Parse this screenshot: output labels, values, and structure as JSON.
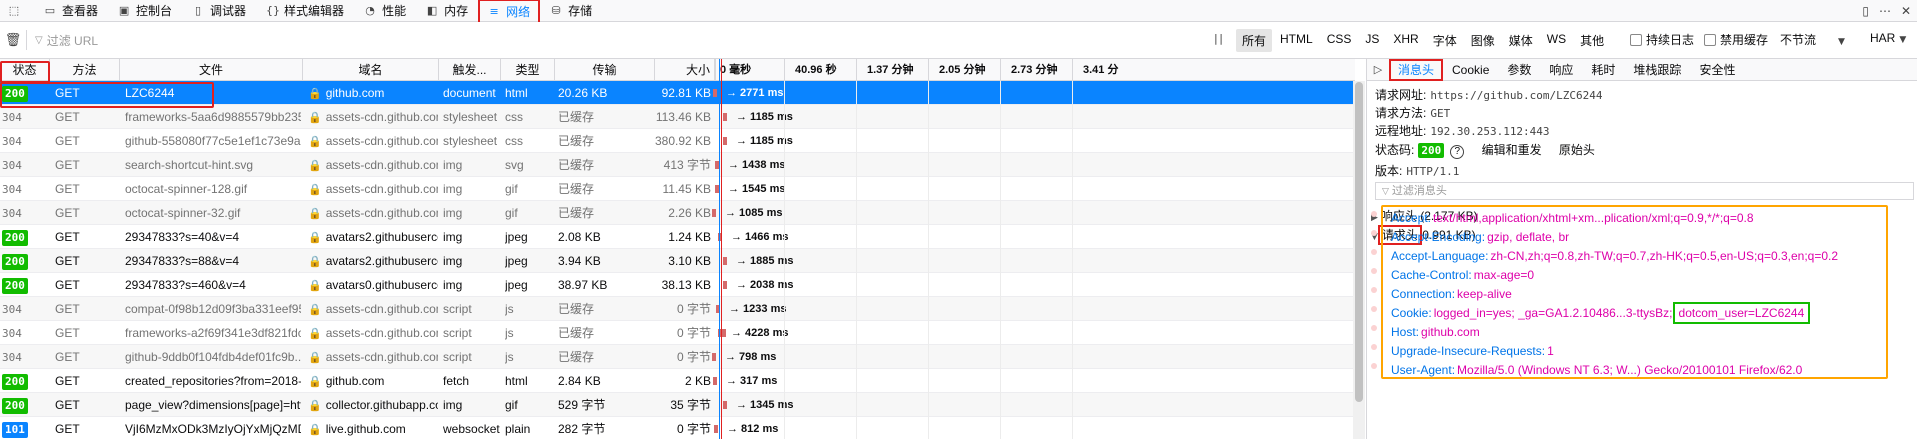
{
  "toolbar": {
    "tabs": [
      {
        "label": "查看器",
        "icon": "inspector-icon"
      },
      {
        "label": "控制台",
        "icon": "console-icon"
      },
      {
        "label": "调试器",
        "icon": "debugger-icon"
      },
      {
        "label": "样式编辑器",
        "icon": "style-editor-icon"
      },
      {
        "label": "性能",
        "icon": "performance-icon"
      },
      {
        "label": "内存",
        "icon": "memory-icon"
      },
      {
        "label": "网络",
        "icon": "network-icon"
      },
      {
        "label": "存储",
        "icon": "storage-icon"
      }
    ],
    "active_tab": "网络"
  },
  "filterbar": {
    "placeholder": "过滤 URL",
    "type_filters": [
      "所有",
      "HTML",
      "CSS",
      "JS",
      "XHR",
      "字体",
      "图像",
      "媒体",
      "WS",
      "其他"
    ],
    "selected_type": "所有",
    "persist_logs": "持续日志",
    "disable_cache": "禁用缓存",
    "throttle": "不节流",
    "har": "HAR"
  },
  "table": {
    "headers": {
      "status": "状态",
      "method": "方法",
      "file": "文件",
      "domain": "域名",
      "cause": "触发...",
      "type": "类型",
      "transferred": "传输",
      "size": "大小",
      "timeline_start": "0 毫秒",
      "ticks": [
        "40.96 秒",
        "1.37 分钟",
        "2.05 分钟",
        "2.73 分钟",
        "3.41 分"
      ]
    },
    "rows": [
      {
        "status": "200",
        "method": "GET",
        "file": "LZC6244",
        "domain": "github.com",
        "cause": "document",
        "type": "html",
        "transferred": "20.26 KB",
        "size": "92.81 KB",
        "time": "→ 2771 ms",
        "selected": true
      },
      {
        "status": "304",
        "method": "GET",
        "file": "frameworks-5aa6d9885579bb2359f...",
        "domain": "assets-cdn.github.com",
        "cause": "stylesheet",
        "type": "css",
        "transferred": "已缓存",
        "size": "113.46 KB",
        "time": "→ 1185 ms"
      },
      {
        "status": "304",
        "method": "GET",
        "file": "github-558080f77c5e1ef1c73e9aac...",
        "domain": "assets-cdn.github.com",
        "cause": "stylesheet",
        "type": "css",
        "transferred": "已缓存",
        "size": "380.92 KB",
        "time": "→ 1185 ms"
      },
      {
        "status": "304",
        "method": "GET",
        "file": "search-shortcut-hint.svg",
        "domain": "assets-cdn.github.com",
        "cause": "img",
        "type": "svg",
        "transferred": "已缓存",
        "size": "413 字节",
        "time": "→ 1438 ms"
      },
      {
        "status": "304",
        "method": "GET",
        "file": "octocat-spinner-128.gif",
        "domain": "assets-cdn.github.com",
        "cause": "img",
        "type": "gif",
        "transferred": "已缓存",
        "size": "11.45 KB",
        "time": "→ 1545 ms"
      },
      {
        "status": "304",
        "method": "GET",
        "file": "octocat-spinner-32.gif",
        "domain": "assets-cdn.github.com",
        "cause": "img",
        "type": "gif",
        "transferred": "已缓存",
        "size": "2.26 KB",
        "time": "→ 1085 ms"
      },
      {
        "status": "200",
        "method": "GET",
        "file": "29347833?s=40&v=4",
        "domain": "avatars2.githubusercon...",
        "cause": "img",
        "type": "jpeg",
        "transferred": "2.08 KB",
        "size": "1.24 KB",
        "time": "→ 1466 ms"
      },
      {
        "status": "200",
        "method": "GET",
        "file": "29347833?s=88&v=4",
        "domain": "avatars2.githubusercon...",
        "cause": "img",
        "type": "jpeg",
        "transferred": "3.94 KB",
        "size": "3.10 KB",
        "time": "→ 1885 ms"
      },
      {
        "status": "200",
        "method": "GET",
        "file": "29347833?s=460&v=4",
        "domain": "avatars0.githubusercon...",
        "cause": "img",
        "type": "jpeg",
        "transferred": "38.97 KB",
        "size": "38.13 KB",
        "time": "→ 2038 ms"
      },
      {
        "status": "304",
        "method": "GET",
        "file": "compat-0f98b12d09f3ba331eef956...",
        "domain": "assets-cdn.github.com",
        "cause": "script",
        "type": "js",
        "transferred": "已缓存",
        "size": "0 字节",
        "time": "→ 1233 ms"
      },
      {
        "status": "304",
        "method": "GET",
        "file": "frameworks-a2f69f341e3df821fdcb...",
        "domain": "assets-cdn.github.com",
        "cause": "script",
        "type": "js",
        "transferred": "已缓存",
        "size": "0 字节",
        "time": "→ 4228 ms"
      },
      {
        "status": "304",
        "method": "GET",
        "file": "github-9ddb0f104fdb4def01fc9b...",
        "domain": "assets-cdn.github.com",
        "cause": "script",
        "type": "js",
        "transferred": "已缓存",
        "size": "0 字节",
        "time": "→ 798 ms"
      },
      {
        "status": "200",
        "method": "GET",
        "file": "created_repositories?from=2018-10...",
        "domain": "github.com",
        "cause": "fetch",
        "type": "html",
        "transferred": "2.84 KB",
        "size": "2 KB",
        "time": "→ 317 ms"
      },
      {
        "status": "200",
        "method": "GET",
        "file": "page_view?dimensions[page]=https...",
        "domain": "collector.githubapp.com",
        "cause": "img",
        "type": "gif",
        "transferred": "529 字节",
        "size": "35 字节",
        "time": "→ 1345 ms"
      },
      {
        "status": "101",
        "method": "GET",
        "file": "VjI6MzMxODk3MzIyOjYxMjQzMDFj...",
        "domain": "live.github.com",
        "cause": "websocket",
        "type": "plain",
        "transferred": "282 字节",
        "size": "0 字节",
        "time": "→ 812 ms"
      }
    ]
  },
  "panel": {
    "tabs": [
      "消息头",
      "Cookie",
      "参数",
      "响应",
      "耗时",
      "堆栈跟踪",
      "安全性"
    ],
    "active_tab": "消息头",
    "url_label": "请求网址:",
    "url": "https://github.com/LZC6244",
    "method_label": "请求方法:",
    "method": "GET",
    "remote_label": "远程地址:",
    "remote": "192.30.253.112:443",
    "status_label": "状态码:",
    "status": "200",
    "edit_resend": "编辑和重发",
    "raw_headers": "原始头",
    "version_label": "版本:",
    "version": "HTTP/1.1",
    "filter_placeholder": "过滤消息头",
    "response_headers": "响应头 (2.177 KB)",
    "request_headers_label": "请求头",
    "request_headers_size": "0.991 KB)",
    "headers": [
      {
        "k": "Accept:",
        "v": "text/html,application/xhtml+xm...plication/xml;q=0.9,*/*;q=0.8"
      },
      {
        "k": "Accept-Encoding:",
        "v": "gzip, deflate, br"
      },
      {
        "k": "Accept-Language:",
        "v": "zh-CN,zh;q=0.8,zh-TW;q=0.7,zh-HK;q=0.5,en-US;q=0.3,en;q=0.2"
      },
      {
        "k": "Cache-Control:",
        "v": "max-age=0"
      },
      {
        "k": "Connection:",
        "v": "keep-alive"
      },
      {
        "k": "Cookie:",
        "v": "logged_in=yes; _ga=GA1.2.10486...3-ttysBz;",
        "v2": "dotcom_user=LZC6244"
      },
      {
        "k": "Host:",
        "v": "github.com"
      },
      {
        "k": "Upgrade-Insecure-Requests:",
        "v": "1"
      },
      {
        "k": "User-Agent:",
        "v": "Mozilla/5.0 (Windows NT 6.3; W...) Gecko/20100101 Firefox/62.0"
      }
    ]
  },
  "colors": {
    "accent": "#0a84ff",
    "ok": "#12bc00",
    "annotation_red": "#e02020",
    "annotation_orange": "#ffa500",
    "annotation_green": "#12bc00",
    "header_key": "#0074e8",
    "header_value": "#dd00a9"
  }
}
